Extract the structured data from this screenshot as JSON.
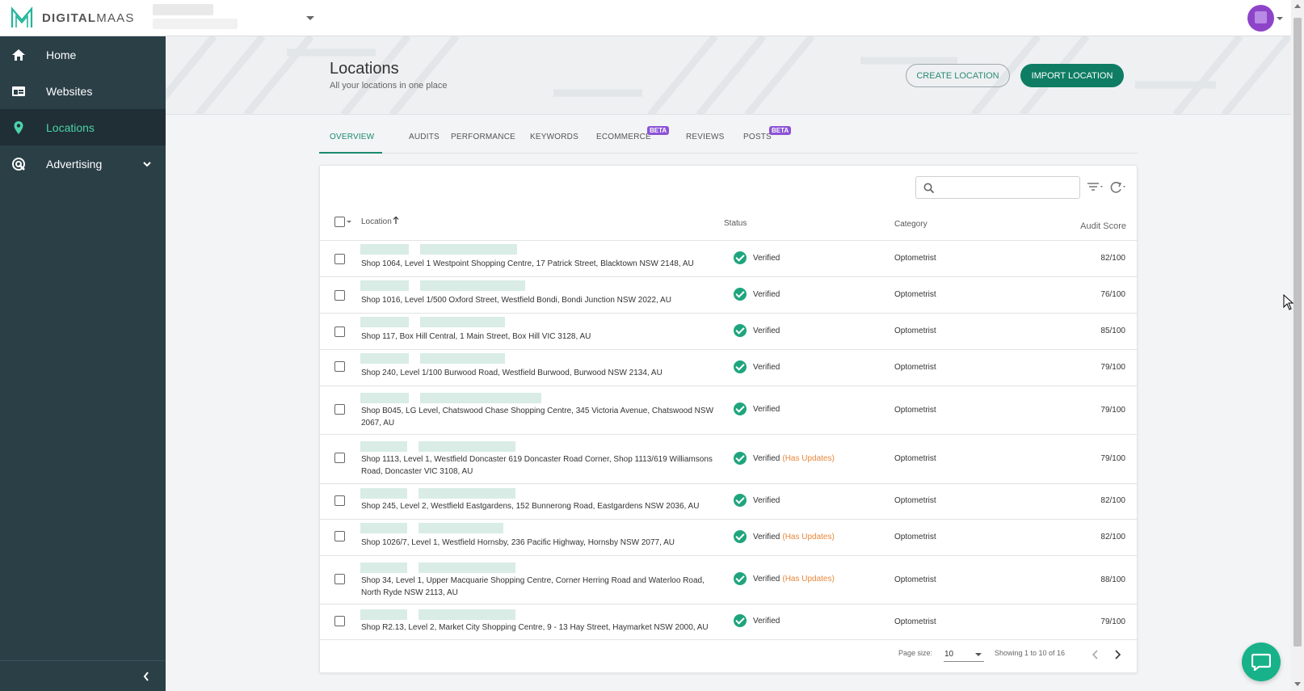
{
  "brand": {
    "name_bold": "DIGITAL",
    "name_light": "MAAS"
  },
  "sidebar": {
    "items": [
      {
        "label": "Home",
        "icon": "home-icon"
      },
      {
        "label": "Websites",
        "icon": "website-icon"
      },
      {
        "label": "Locations",
        "icon": "location-pin-icon",
        "active": true
      },
      {
        "label": "Advertising",
        "icon": "advertising-icon",
        "expandable": true
      }
    ]
  },
  "header": {
    "title": "Locations",
    "subtitle": "All your locations in one place",
    "create_label": "CREATE LOCATION",
    "import_label": "IMPORT LOCATION"
  },
  "tabs": [
    {
      "label": "OVERVIEW",
      "active": true
    },
    {
      "label": "AUDITS"
    },
    {
      "label": "PERFORMANCE"
    },
    {
      "label": "KEYWORDS"
    },
    {
      "label": "ECOMMERCE",
      "badge": "BETA"
    },
    {
      "label": "REVIEWS"
    },
    {
      "label": "POSTS",
      "badge": "BETA"
    }
  ],
  "table": {
    "search_placeholder": "",
    "columns": {
      "location": "Location",
      "status": "Status",
      "category": "Category",
      "score": "Audit Score"
    },
    "rows": [
      {
        "address": "Shop 1064, Level 1 Westpoint Shopping Centre, 17 Patrick Street, Blacktown NSW 2148, AU",
        "status": "Verified",
        "updates": "",
        "category": "Optometrist",
        "score": "82/100"
      },
      {
        "address": "Shop 1016, Level 1/500 Oxford Street, Westfield Bondi, Bondi Junction NSW 2022, AU",
        "status": "Verified",
        "updates": "",
        "category": "Optometrist",
        "score": "76/100"
      },
      {
        "address": "Shop 117, Box Hill Central, 1 Main Street, Box Hill VIC 3128, AU",
        "status": "Verified",
        "updates": "",
        "category": "Optometrist",
        "score": "85/100"
      },
      {
        "address": "Shop 240, Level 1/100 Burwood Road, Westfield Burwood, Burwood NSW 2134, AU",
        "status": "Verified",
        "updates": "",
        "category": "Optometrist",
        "score": "79/100"
      },
      {
        "address": "Shop B045, LG Level, Chatswood Chase Shopping Centre, 345 Victoria Avenue, Chatswood NSW 2067, AU",
        "status": "Verified",
        "updates": "",
        "category": "Optometrist",
        "score": "79/100"
      },
      {
        "address": "Shop 1113, Level 1, Westfield Doncaster 619 Doncaster Road Corner, Shop 1113/619 Williamsons Road, Doncaster VIC 3108, AU",
        "status": "Verified",
        "updates": "(Has Updates)",
        "category": "Optometrist",
        "score": "79/100"
      },
      {
        "address": "Shop 245, Level 2, Westfield Eastgardens, 152 Bunnerong Road, Eastgardens NSW 2036, AU",
        "status": "Verified",
        "updates": "",
        "category": "Optometrist",
        "score": "82/100"
      },
      {
        "address": "Shop 1026/7, Level 1, Westfield Hornsby, 236 Pacific Highway, Hornsby NSW 2077, AU",
        "status": "Verified",
        "updates": "(Has Updates)",
        "category": "Optometrist",
        "score": "82/100"
      },
      {
        "address": "Shop 34, Level 1, Upper Macquarie Shopping Centre, Corner Herring Road and Waterloo Road, North Ryde NSW 2113, AU",
        "status": "Verified",
        "updates": "(Has Updates)",
        "category": "Optometrist",
        "score": "88/100"
      },
      {
        "address": "Shop R2.13, Level 2, Market City Shopping Centre, 9 - 13 Hay Street, Haymarket NSW 2000, AU",
        "status": "Verified",
        "updates": "",
        "category": "Optometrist",
        "score": "79/100"
      }
    ]
  },
  "pagination": {
    "page_size_label": "Page size:",
    "page_size": "10",
    "showing": "Showing 1 to 10 of 16"
  },
  "colors": {
    "accent": "#0e7d63",
    "sidebar": "#2b3f47",
    "active_nav": "#4ed2a9",
    "beta": "#8b52d6",
    "updates": "#e8873a"
  }
}
